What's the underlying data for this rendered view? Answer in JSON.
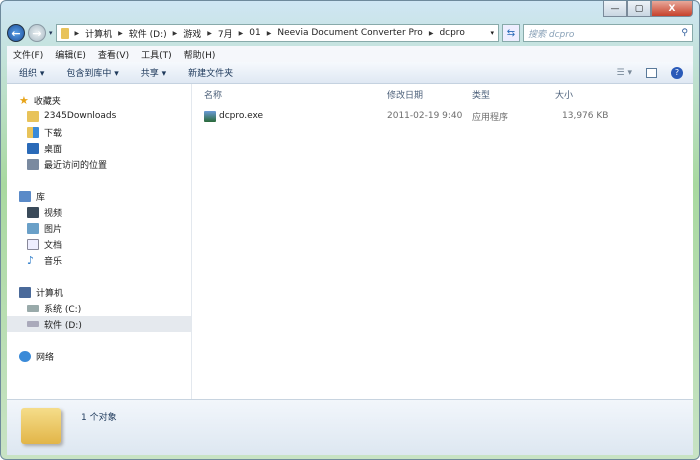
{
  "window": {
    "minimize": "—",
    "maximize": "▢",
    "close": "X"
  },
  "address": {
    "crumbs": [
      "计算机",
      "软件 (D:)",
      "游戏",
      "7月",
      "01",
      "Neevia Document Converter Pro",
      "dcpro"
    ],
    "search_placeholder": "搜索 dcpro"
  },
  "menu": [
    "文件(F)",
    "编辑(E)",
    "查看(V)",
    "工具(T)",
    "帮助(H)"
  ],
  "toolbar": {
    "organize": "组织 ▾",
    "include": "包含到库中 ▾",
    "share": "共享 ▾",
    "new_folder": "新建文件夹"
  },
  "sidebar": {
    "favorites": {
      "label": "收藏夹",
      "items": [
        "2345Downloads",
        "下载",
        "桌面",
        "最近访问的位置"
      ]
    },
    "libraries": {
      "label": "库",
      "items": [
        "视频",
        "图片",
        "文档",
        "音乐"
      ]
    },
    "computer": {
      "label": "计算机",
      "items": [
        "系统 (C:)",
        "软件 (D:)"
      ]
    },
    "network": {
      "label": "网络"
    }
  },
  "columns": [
    "名称",
    "修改日期",
    "类型",
    "大小"
  ],
  "files": [
    {
      "name": "dcpro.exe",
      "modified": "2011-02-19 9:40",
      "type": "应用程序",
      "size": "13,976 KB"
    }
  ],
  "status": {
    "text": "1 个对象"
  }
}
